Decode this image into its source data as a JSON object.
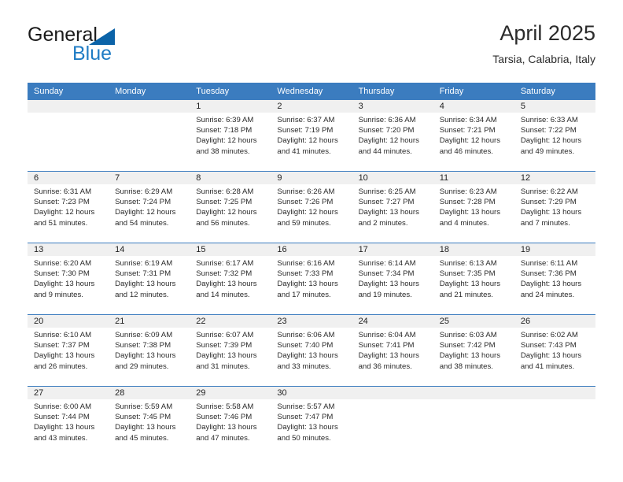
{
  "brand": {
    "name_part1": "General",
    "name_part2": "Blue",
    "logo_icon": "blue-triangle-icon",
    "accent_color": "#1f7cc4"
  },
  "header": {
    "title": "April 2025",
    "subtitle": "Tarsia, Calabria, Italy"
  },
  "theme": {
    "header_row_bg": "#3b7cbf",
    "daynum_band_bg": "#f0f0f0",
    "grid_line": "#3b7cbf",
    "text": "#2a2a2a"
  },
  "weekday_headers": [
    "Sunday",
    "Monday",
    "Tuesday",
    "Wednesday",
    "Thursday",
    "Friday",
    "Saturday"
  ],
  "weeks": [
    [
      {
        "day": "",
        "empty": true,
        "sunrise": "",
        "sunset": "",
        "daylight_line1": "",
        "daylight_line2": ""
      },
      {
        "day": "",
        "empty": true,
        "sunrise": "",
        "sunset": "",
        "daylight_line1": "",
        "daylight_line2": ""
      },
      {
        "day": "1",
        "sunrise": "Sunrise: 6:39 AM",
        "sunset": "Sunset: 7:18 PM",
        "daylight_line1": "Daylight: 12 hours",
        "daylight_line2": "and 38 minutes."
      },
      {
        "day": "2",
        "sunrise": "Sunrise: 6:37 AM",
        "sunset": "Sunset: 7:19 PM",
        "daylight_line1": "Daylight: 12 hours",
        "daylight_line2": "and 41 minutes."
      },
      {
        "day": "3",
        "sunrise": "Sunrise: 6:36 AM",
        "sunset": "Sunset: 7:20 PM",
        "daylight_line1": "Daylight: 12 hours",
        "daylight_line2": "and 44 minutes."
      },
      {
        "day": "4",
        "sunrise": "Sunrise: 6:34 AM",
        "sunset": "Sunset: 7:21 PM",
        "daylight_line1": "Daylight: 12 hours",
        "daylight_line2": "and 46 minutes."
      },
      {
        "day": "5",
        "sunrise": "Sunrise: 6:33 AM",
        "sunset": "Sunset: 7:22 PM",
        "daylight_line1": "Daylight: 12 hours",
        "daylight_line2": "and 49 minutes."
      }
    ],
    [
      {
        "day": "6",
        "sunrise": "Sunrise: 6:31 AM",
        "sunset": "Sunset: 7:23 PM",
        "daylight_line1": "Daylight: 12 hours",
        "daylight_line2": "and 51 minutes."
      },
      {
        "day": "7",
        "sunrise": "Sunrise: 6:29 AM",
        "sunset": "Sunset: 7:24 PM",
        "daylight_line1": "Daylight: 12 hours",
        "daylight_line2": "and 54 minutes."
      },
      {
        "day": "8",
        "sunrise": "Sunrise: 6:28 AM",
        "sunset": "Sunset: 7:25 PM",
        "daylight_line1": "Daylight: 12 hours",
        "daylight_line2": "and 56 minutes."
      },
      {
        "day": "9",
        "sunrise": "Sunrise: 6:26 AM",
        "sunset": "Sunset: 7:26 PM",
        "daylight_line1": "Daylight: 12 hours",
        "daylight_line2": "and 59 minutes."
      },
      {
        "day": "10",
        "sunrise": "Sunrise: 6:25 AM",
        "sunset": "Sunset: 7:27 PM",
        "daylight_line1": "Daylight: 13 hours",
        "daylight_line2": "and 2 minutes."
      },
      {
        "day": "11",
        "sunrise": "Sunrise: 6:23 AM",
        "sunset": "Sunset: 7:28 PM",
        "daylight_line1": "Daylight: 13 hours",
        "daylight_line2": "and 4 minutes."
      },
      {
        "day": "12",
        "sunrise": "Sunrise: 6:22 AM",
        "sunset": "Sunset: 7:29 PM",
        "daylight_line1": "Daylight: 13 hours",
        "daylight_line2": "and 7 minutes."
      }
    ],
    [
      {
        "day": "13",
        "sunrise": "Sunrise: 6:20 AM",
        "sunset": "Sunset: 7:30 PM",
        "daylight_line1": "Daylight: 13 hours",
        "daylight_line2": "and 9 minutes."
      },
      {
        "day": "14",
        "sunrise": "Sunrise: 6:19 AM",
        "sunset": "Sunset: 7:31 PM",
        "daylight_line1": "Daylight: 13 hours",
        "daylight_line2": "and 12 minutes."
      },
      {
        "day": "15",
        "sunrise": "Sunrise: 6:17 AM",
        "sunset": "Sunset: 7:32 PM",
        "daylight_line1": "Daylight: 13 hours",
        "daylight_line2": "and 14 minutes."
      },
      {
        "day": "16",
        "sunrise": "Sunrise: 6:16 AM",
        "sunset": "Sunset: 7:33 PM",
        "daylight_line1": "Daylight: 13 hours",
        "daylight_line2": "and 17 minutes."
      },
      {
        "day": "17",
        "sunrise": "Sunrise: 6:14 AM",
        "sunset": "Sunset: 7:34 PM",
        "daylight_line1": "Daylight: 13 hours",
        "daylight_line2": "and 19 minutes."
      },
      {
        "day": "18",
        "sunrise": "Sunrise: 6:13 AM",
        "sunset": "Sunset: 7:35 PM",
        "daylight_line1": "Daylight: 13 hours",
        "daylight_line2": "and 21 minutes."
      },
      {
        "day": "19",
        "sunrise": "Sunrise: 6:11 AM",
        "sunset": "Sunset: 7:36 PM",
        "daylight_line1": "Daylight: 13 hours",
        "daylight_line2": "and 24 minutes."
      }
    ],
    [
      {
        "day": "20",
        "sunrise": "Sunrise: 6:10 AM",
        "sunset": "Sunset: 7:37 PM",
        "daylight_line1": "Daylight: 13 hours",
        "daylight_line2": "and 26 minutes."
      },
      {
        "day": "21",
        "sunrise": "Sunrise: 6:09 AM",
        "sunset": "Sunset: 7:38 PM",
        "daylight_line1": "Daylight: 13 hours",
        "daylight_line2": "and 29 minutes."
      },
      {
        "day": "22",
        "sunrise": "Sunrise: 6:07 AM",
        "sunset": "Sunset: 7:39 PM",
        "daylight_line1": "Daylight: 13 hours",
        "daylight_line2": "and 31 minutes."
      },
      {
        "day": "23",
        "sunrise": "Sunrise: 6:06 AM",
        "sunset": "Sunset: 7:40 PM",
        "daylight_line1": "Daylight: 13 hours",
        "daylight_line2": "and 33 minutes."
      },
      {
        "day": "24",
        "sunrise": "Sunrise: 6:04 AM",
        "sunset": "Sunset: 7:41 PM",
        "daylight_line1": "Daylight: 13 hours",
        "daylight_line2": "and 36 minutes."
      },
      {
        "day": "25",
        "sunrise": "Sunrise: 6:03 AM",
        "sunset": "Sunset: 7:42 PM",
        "daylight_line1": "Daylight: 13 hours",
        "daylight_line2": "and 38 minutes."
      },
      {
        "day": "26",
        "sunrise": "Sunrise: 6:02 AM",
        "sunset": "Sunset: 7:43 PM",
        "daylight_line1": "Daylight: 13 hours",
        "daylight_line2": "and 41 minutes."
      }
    ],
    [
      {
        "day": "27",
        "sunrise": "Sunrise: 6:00 AM",
        "sunset": "Sunset: 7:44 PM",
        "daylight_line1": "Daylight: 13 hours",
        "daylight_line2": "and 43 minutes."
      },
      {
        "day": "28",
        "sunrise": "Sunrise: 5:59 AM",
        "sunset": "Sunset: 7:45 PM",
        "daylight_line1": "Daylight: 13 hours",
        "daylight_line2": "and 45 minutes."
      },
      {
        "day": "29",
        "sunrise": "Sunrise: 5:58 AM",
        "sunset": "Sunset: 7:46 PM",
        "daylight_line1": "Daylight: 13 hours",
        "daylight_line2": "and 47 minutes."
      },
      {
        "day": "30",
        "sunrise": "Sunrise: 5:57 AM",
        "sunset": "Sunset: 7:47 PM",
        "daylight_line1": "Daylight: 13 hours",
        "daylight_line2": "and 50 minutes."
      },
      {
        "day": "",
        "empty": true,
        "sunrise": "",
        "sunset": "",
        "daylight_line1": "",
        "daylight_line2": ""
      },
      {
        "day": "",
        "empty": true,
        "sunrise": "",
        "sunset": "",
        "daylight_line1": "",
        "daylight_line2": ""
      },
      {
        "day": "",
        "empty": true,
        "sunrise": "",
        "sunset": "",
        "daylight_line1": "",
        "daylight_line2": ""
      }
    ]
  ]
}
